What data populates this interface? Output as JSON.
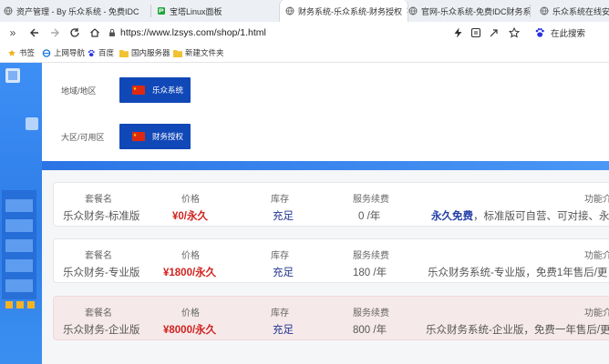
{
  "browser": {
    "tabs": [
      {
        "title": "资产管理 - By 乐众系统 - 免费IDC",
        "active": false
      },
      {
        "title": "宝塔Linux面板",
        "active": false
      },
      {
        "title": "财务系统-乐众系统-财务授权",
        "active": true
      },
      {
        "title": "官网-乐众系统-免费IDC财务系统",
        "active": false
      },
      {
        "title": "乐众系统在线安装",
        "active": false
      }
    ],
    "url": "https://www.lzsys.com/shop/1.html",
    "search_label": "在此搜索",
    "bookmarks": [
      "书签",
      "上网导航",
      "百度",
      "国内服务器",
      "新建文件夹"
    ]
  },
  "page": {
    "region_label": "地域/地区",
    "region_option": "乐众系统",
    "zone_label": "大区/可用区",
    "zone_option": "财务授权",
    "plans": [
      {
        "headers": {
          "name": "套餐名",
          "price": "价格",
          "stock": "库存",
          "renewal": "服务续费",
          "features": "功能介"
        },
        "name": "乐众财务-标准版",
        "price": "¥0/永久",
        "stock": "充足",
        "renewal": "0 /年",
        "feature_highlight": "永久免费",
        "features": "，标准版可自营、可对接、永久"
      },
      {
        "headers": {
          "name": "套餐名",
          "price": "价格",
          "stock": "库存",
          "renewal": "服务续费",
          "features": "功能介"
        },
        "name": "乐众财务-专业版",
        "price": "¥1800/永久",
        "stock": "充足",
        "renewal": "180 /年",
        "feature_highlight": "",
        "features": "乐众财务系统-专业版，免费1年售后/更"
      },
      {
        "headers": {
          "name": "套餐名",
          "price": "价格",
          "stock": "库存",
          "renewal": "服务续费",
          "features": "功能介"
        },
        "name": "乐众财务-企业版",
        "price": "¥8000/永久",
        "stock": "充足",
        "renewal": "800 /年",
        "feature_highlight": "",
        "features": "乐众财务系统-企业版，免费一年售后/更"
      }
    ]
  },
  "colors": {
    "accent_blue": "#1148b8",
    "price_red": "#d0231f",
    "stock_navy": "#23358f",
    "highlight_card": "#f6e9ea"
  }
}
